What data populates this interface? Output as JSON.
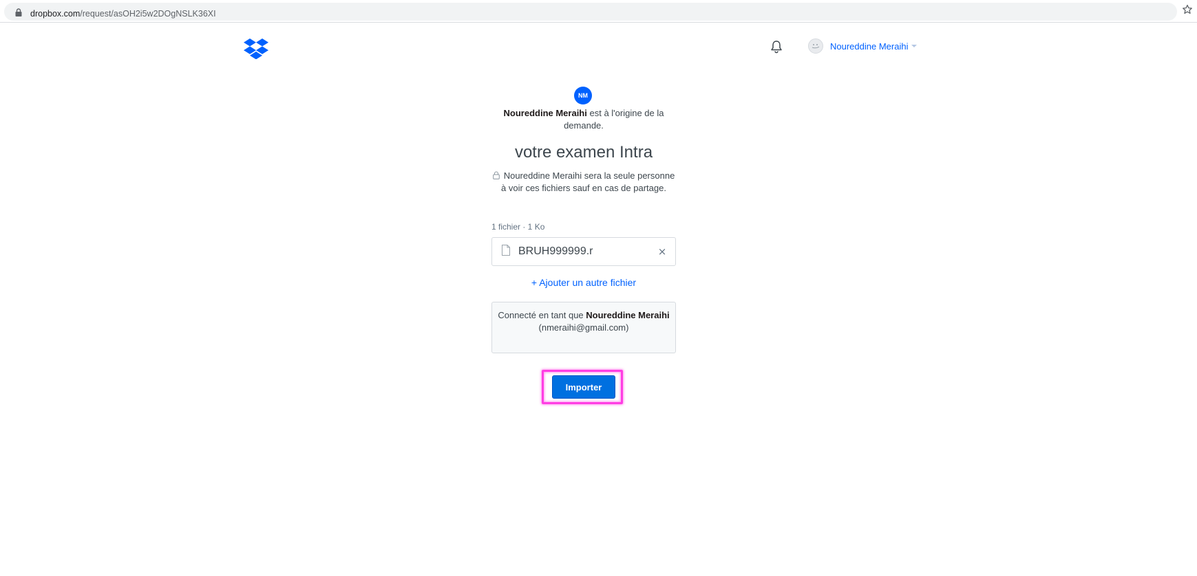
{
  "browser": {
    "url_domain": "dropbox.com",
    "url_path": "/request/asOH2i5w2DOgNSLK36XI"
  },
  "header": {
    "user_name": "Noureddine Meraihi"
  },
  "request": {
    "avatar_initials": "NM",
    "origin_name": "Noureddine Meraihi",
    "origin_text": " est à l'origine de la demande.",
    "title": "votre examen Intra",
    "privacy_text": "Noureddine Meraihi sera la seule personne à voir ces fichiers sauf en cas de partage.",
    "file_count": "1 fichier · 1 Ko",
    "files": [
      {
        "name": "BRUH999999.r"
      }
    ],
    "add_file_label": "+ Ajouter un autre fichier",
    "connected_prefix": "Connecté en tant que ",
    "connected_name": "Noureddine Meraihi",
    "connected_email": "(nmeraihi@gmail.com)",
    "import_label": "Importer"
  },
  "colors": {
    "brand_blue": "#0061fe",
    "button_blue": "#0070e0",
    "highlight": "#ff3de3"
  }
}
